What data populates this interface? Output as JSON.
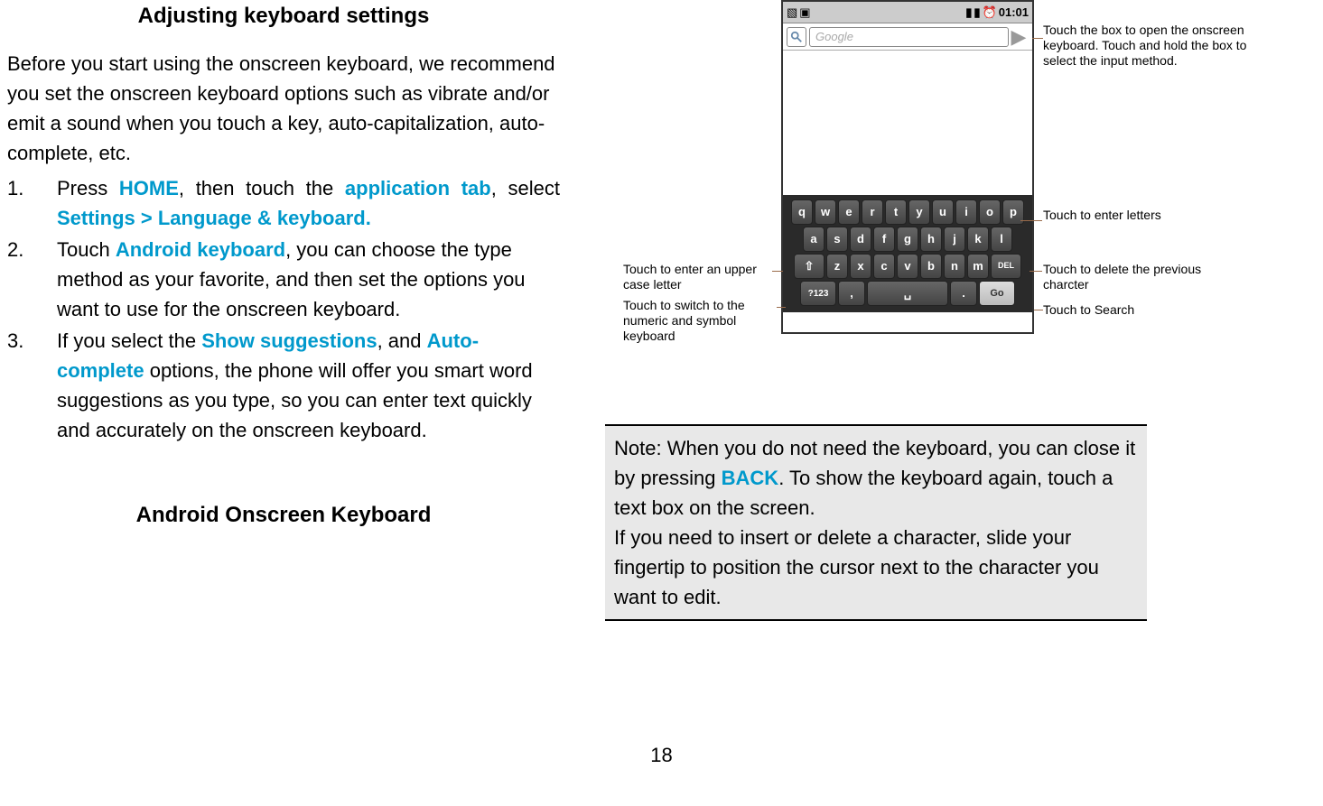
{
  "left": {
    "title": "Adjusting keyboard settings",
    "intro": "Before you start using the onscreen keyboard, we recommend you set the onscreen keyboard options such as vibrate and/or emit a sound when you touch a key, auto-capitalization, auto-complete, etc.",
    "steps": {
      "s1_num": "1.",
      "s1_a": "Press ",
      "s1_home": "HOME",
      "s1_b": ", then touch the ",
      "s1_apptab": "application tab",
      "s1_c": ", select ",
      "s1_settings": "Settings > Language & keyboard.",
      "s2_num": "2.",
      "s2_a": "Touch ",
      "s2_android": "Android keyboard",
      "s2_b": ", you can choose the type method as your favorite, and then set the options you want to use for the onscreen keyboard.",
      "s3_num": "3.",
      "s3_a": "If you select the ",
      "s3_show": "Show suggestions",
      "s3_b": ", and ",
      "s3_auto": "Auto-complete",
      "s3_c": " options, the phone will offer you smart word suggestions as you type, so you can enter text quickly and accurately on the onscreen keyboard."
    },
    "subtitle": "Android Onscreen Keyboard"
  },
  "diagram": {
    "time": "01:01",
    "search_placeholder": "Google",
    "rows": {
      "r1": [
        "q",
        "w",
        "e",
        "r",
        "t",
        "y",
        "u",
        "i",
        "o",
        "p"
      ],
      "r2": [
        "a",
        "s",
        "d",
        "f",
        "g",
        "h",
        "j",
        "k",
        "l"
      ],
      "r3_shift": "⇧",
      "r3": [
        "z",
        "x",
        "c",
        "v",
        "b",
        "n",
        "m"
      ],
      "r3_del": "DEL",
      "r4_num": "?123",
      "r4_comma": ",",
      "r4_space": "␣",
      "r4_period": ".",
      "r4_go": "Go"
    },
    "annotations": {
      "top_right": "Touch the box to open the onscreen keyboard. Touch and hold the box to select the input method.",
      "letters": "Touch to enter letters",
      "delete": "Touch to delete the previous charcter",
      "search": "Touch to Search",
      "upper": "Touch to enter an upper case letter",
      "numeric": "Touch to switch to the numeric and symbol keyboard"
    }
  },
  "note": {
    "a": "Note: When you do not need the keyboard, you can close it by pressing ",
    "back": "BACK",
    "b": ". To show the keyboard again, touch a text box on the screen.",
    "c": "If you need to insert or delete a character, slide your fingertip to position the cursor next to the character you want to edit."
  },
  "page_num": "18"
}
